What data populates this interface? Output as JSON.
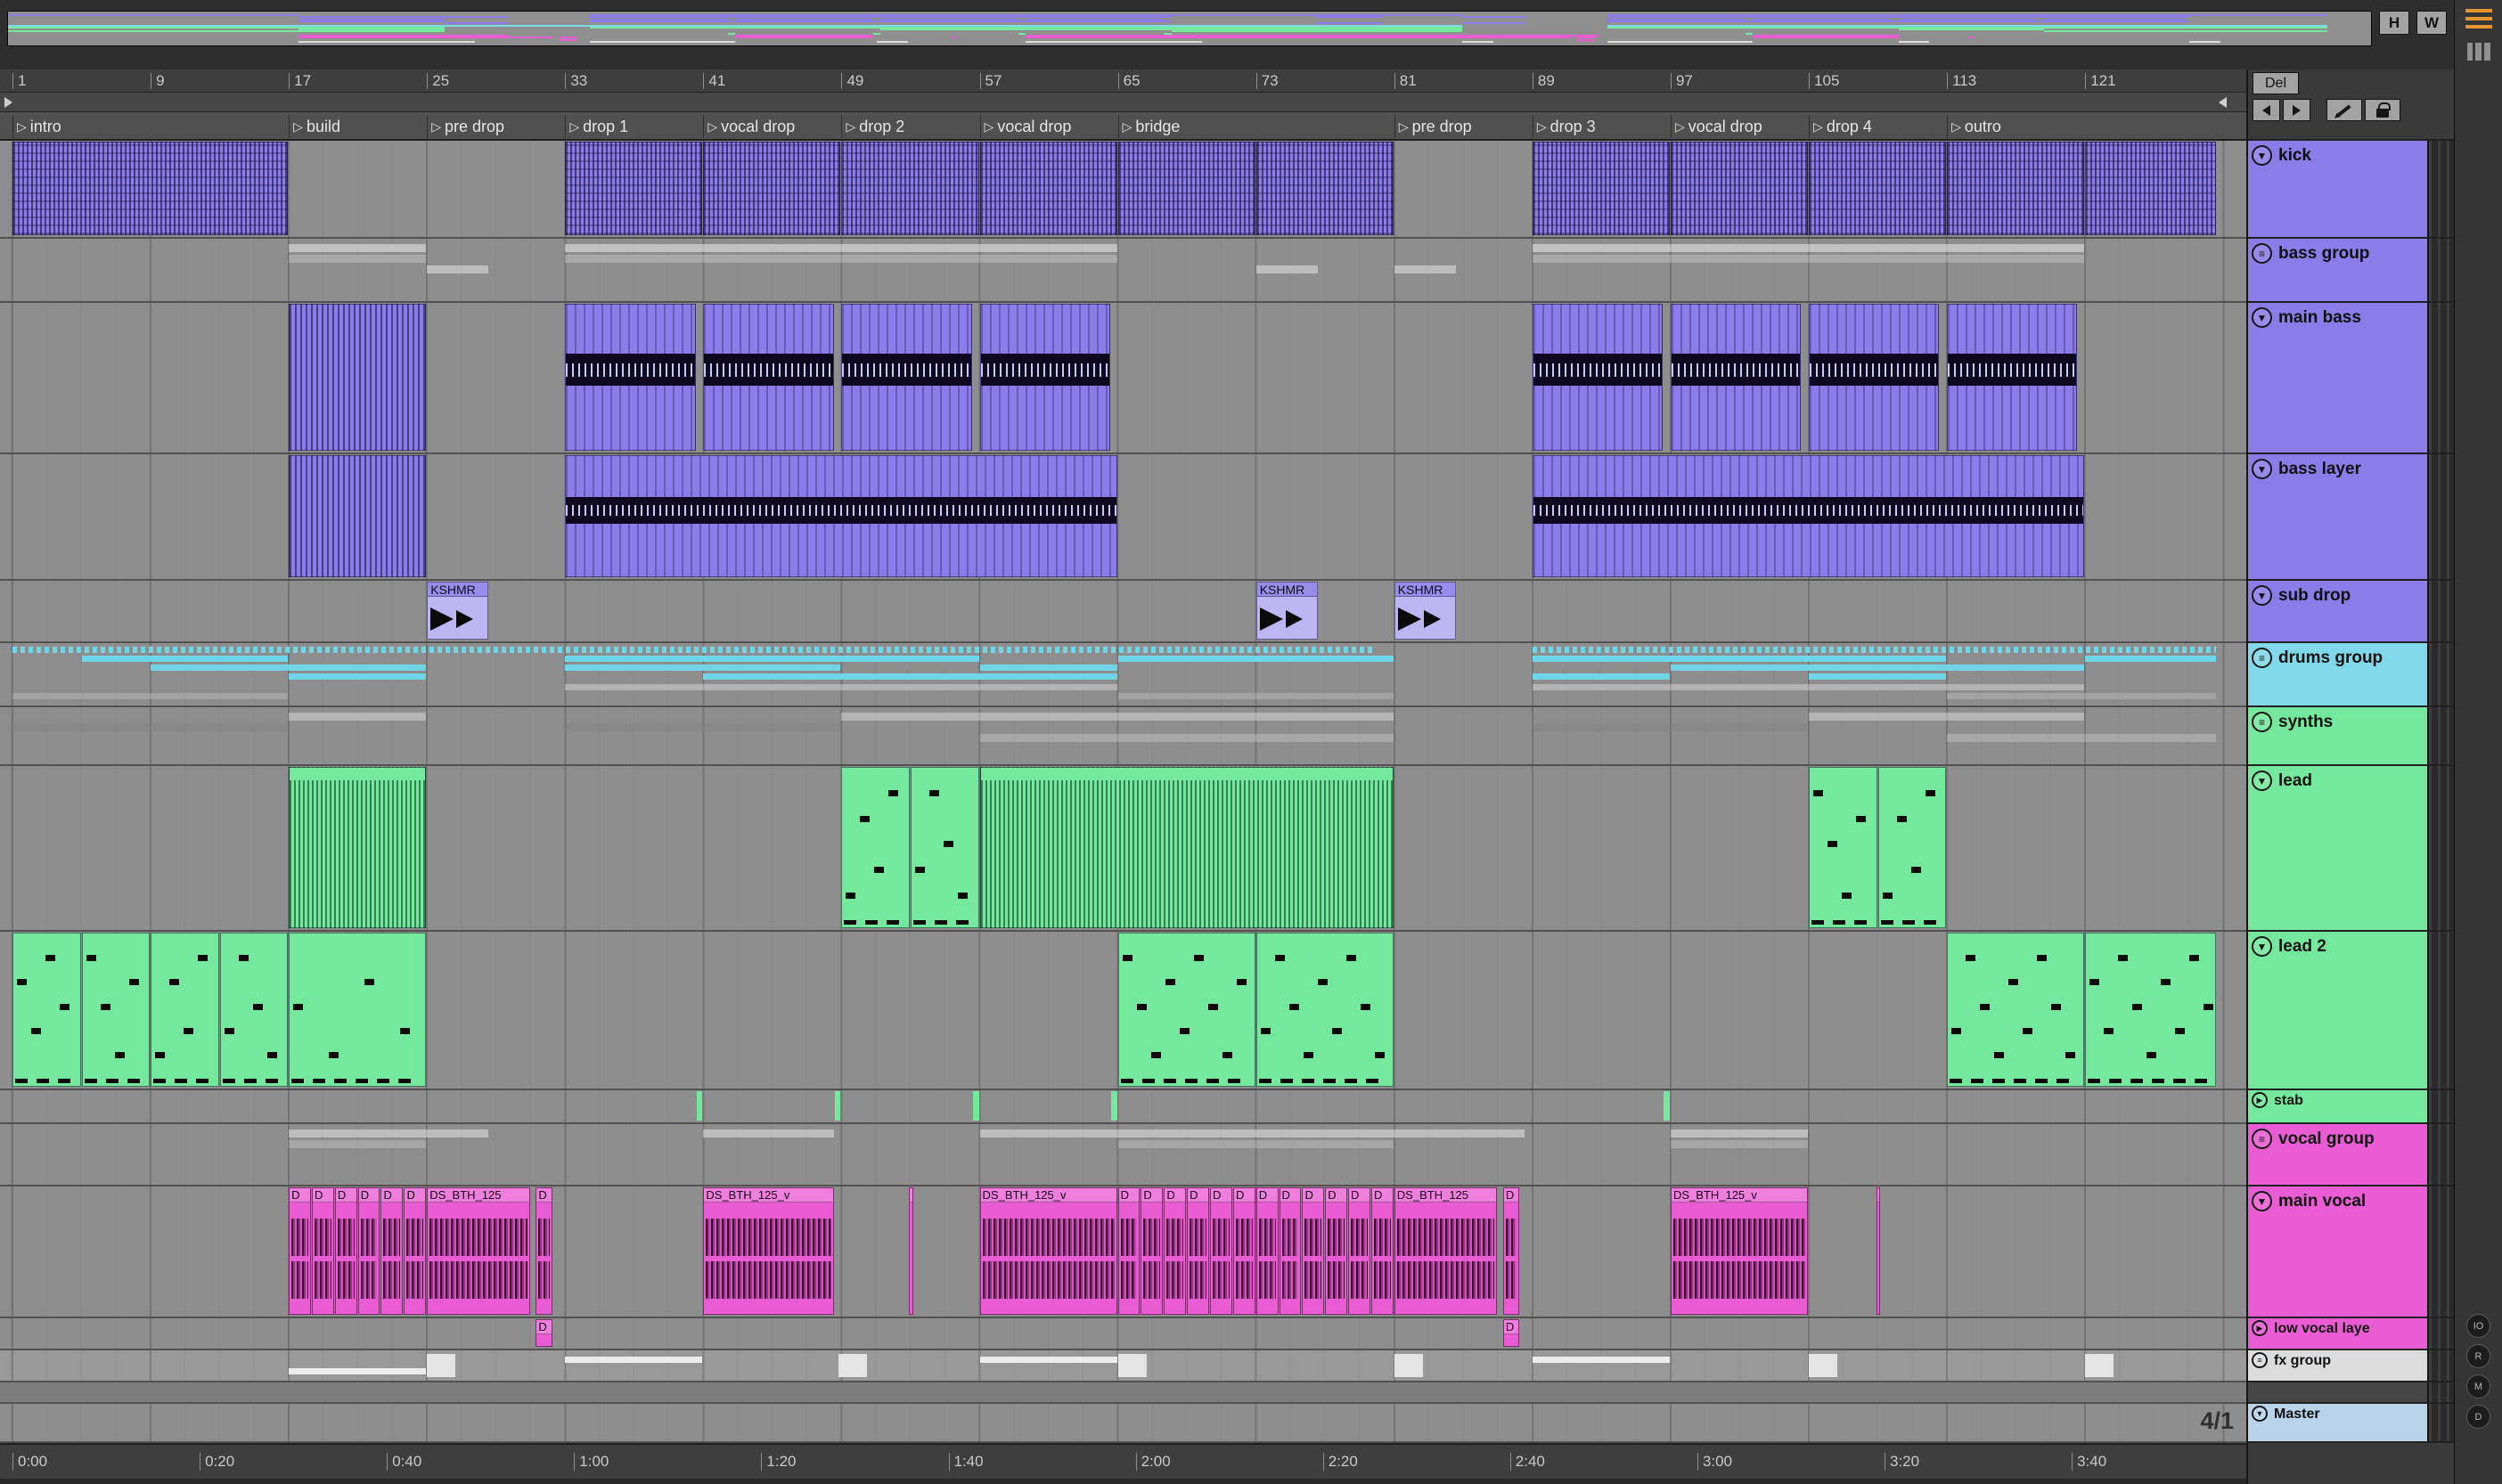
{
  "topbar": {
    "h": "H",
    "w": "W"
  },
  "corner": {
    "del": "Del"
  },
  "colors": {
    "purple": "#8b7ce9",
    "green": "#74e89c",
    "cyan": "#7fd9e9",
    "magenta": "#ea5cd3",
    "master_blue": "#b9d4ea",
    "selected_gray": "#dcdcdc",
    "menu_orange": "#e8952e"
  },
  "timeline": {
    "bar_numbers": [
      "1",
      "9",
      "17",
      "25",
      "33",
      "41",
      "49",
      "57",
      "65",
      "73",
      "81",
      "89",
      "97",
      "105",
      "113",
      "121"
    ]
  },
  "locators": [
    {
      "name": "intro",
      "bar": 1
    },
    {
      "name": "build",
      "bar": 17
    },
    {
      "name": "pre drop",
      "bar": 25
    },
    {
      "name": "drop 1",
      "bar": 33
    },
    {
      "name": "vocal drop",
      "bar": 41
    },
    {
      "name": "drop 2",
      "bar": 49
    },
    {
      "name": "vocal drop",
      "bar": 57
    },
    {
      "name": "bridge",
      "bar": 65
    },
    {
      "name": "pre drop",
      "bar": 81
    },
    {
      "name": "drop 3",
      "bar": 89
    },
    {
      "name": "vocal drop",
      "bar": 97
    },
    {
      "name": "drop 4",
      "bar": 105
    },
    {
      "name": "outro",
      "bar": 113
    }
  ],
  "time_ruler": [
    "0:00",
    "0:20",
    "0:40",
    "1:00",
    "1:20",
    "1:40",
    "2:00",
    "2:20",
    "2:40",
    "3:00",
    "3:20",
    "3:40"
  ],
  "right_rail": {
    "menu_icon": "hamburger-menu",
    "panel_icon": "panel-toggle",
    "circles": [
      "IO",
      "R",
      "M",
      "D"
    ]
  },
  "tracks": [
    {
      "name": "kick",
      "color": "#8b7ce9",
      "height": 110,
      "icon": "fold-open",
      "clips": [
        {
          "s": 1,
          "e": 17,
          "t": "kick"
        },
        {
          "s": 33,
          "e": 41,
          "t": "kick"
        },
        {
          "s": 41,
          "e": 49,
          "t": "kick"
        },
        {
          "s": 49,
          "e": 57,
          "t": "kick"
        },
        {
          "s": 57,
          "e": 65,
          "t": "kick"
        },
        {
          "s": 65,
          "e": 73,
          "t": "kick"
        },
        {
          "s": 73,
          "e": 81,
          "t": "kick"
        },
        {
          "s": 89,
          "e": 97,
          "t": "kick"
        },
        {
          "s": 97,
          "e": 105,
          "t": "kick"
        },
        {
          "s": 105,
          "e": 113,
          "t": "kick"
        },
        {
          "s": 113,
          "e": 121,
          "t": "kick"
        },
        {
          "s": 121,
          "e": 128.6,
          "t": "kick"
        }
      ]
    },
    {
      "name": "bass group",
      "color": "#8b7ce9",
      "height": 72,
      "icon": "unfold-group",
      "clips": [
        {
          "s": 17,
          "e": 25,
          "t": "bar",
          "y": 6,
          "h": 9,
          "c": "rgba(235,235,235,0.55)"
        },
        {
          "s": 33,
          "e": 65,
          "t": "bar",
          "y": 6,
          "h": 9,
          "c": "rgba(235,235,235,0.55)"
        },
        {
          "s": 89,
          "e": 121,
          "t": "bar",
          "y": 6,
          "h": 9,
          "c": "rgba(235,235,235,0.55)"
        },
        {
          "s": 17,
          "e": 25,
          "t": "bar",
          "y": 18,
          "h": 9,
          "c": "rgba(210,210,210,0.4)"
        },
        {
          "s": 33,
          "e": 65,
          "t": "bar",
          "y": 18,
          "h": 9,
          "c": "rgba(210,210,210,0.4)"
        },
        {
          "s": 89,
          "e": 121,
          "t": "bar",
          "y": 18,
          "h": 9,
          "c": "rgba(210,210,210,0.4)"
        },
        {
          "s": 25,
          "e": 28.6,
          "t": "bar",
          "y": 30,
          "h": 9,
          "c": "rgba(235,235,235,0.5)"
        },
        {
          "s": 73,
          "e": 76.6,
          "t": "bar",
          "y": 30,
          "h": 9,
          "c": "rgba(235,235,235,0.5)"
        },
        {
          "s": 81,
          "e": 84.6,
          "t": "bar",
          "y": 30,
          "h": 9,
          "c": "rgba(235,235,235,0.5)"
        }
      ]
    },
    {
      "name": "main bass",
      "color": "#8b7ce9",
      "height": 170,
      "icon": "fold-open",
      "clips": [
        {
          "s": 17,
          "e": 25,
          "t": "bstripe"
        },
        {
          "s": 33,
          "e": 40.6,
          "t": "bass"
        },
        {
          "s": 41,
          "e": 48.6,
          "t": "bass"
        },
        {
          "s": 49,
          "e": 56.6,
          "t": "bass"
        },
        {
          "s": 57,
          "e": 64.6,
          "t": "bass"
        },
        {
          "s": 89,
          "e": 96.6,
          "t": "bass"
        },
        {
          "s": 97,
          "e": 104.6,
          "t": "bass"
        },
        {
          "s": 105,
          "e": 112.6,
          "t": "bass"
        },
        {
          "s": 113,
          "e": 120.6,
          "t": "bass"
        }
      ]
    },
    {
      "name": "bass layer",
      "color": "#8b7ce9",
      "height": 142,
      "icon": "fold-open",
      "clips": [
        {
          "s": 17,
          "e": 25,
          "t": "bstripe"
        },
        {
          "s": 33,
          "e": 65,
          "t": "bass"
        },
        {
          "s": 89,
          "e": 121,
          "t": "bass"
        }
      ]
    },
    {
      "name": "sub drop",
      "color": "#8b7ce9",
      "height": 70,
      "icon": "fold-open",
      "clips": [
        {
          "s": 25,
          "e": 28.6,
          "t": "kshmr",
          "name": "KSHMR"
        },
        {
          "s": 73,
          "e": 76.6,
          "t": "kshmr",
          "name": "KSHMR"
        },
        {
          "s": 81,
          "e": 84.6,
          "t": "kshmr",
          "name": "KSHMR"
        }
      ]
    },
    {
      "name": "drums group",
      "color": "#7fd9e9",
      "height": 72,
      "icon": "unfold-group",
      "clips": [
        {
          "s": 1,
          "e": 80,
          "t": "bar",
          "y": 4,
          "h": 7,
          "c": "#6fd6ea",
          "dash": true
        },
        {
          "s": 89,
          "e": 128.6,
          "t": "bar",
          "y": 4,
          "h": 7,
          "c": "#6fd6ea",
          "dash": true
        },
        {
          "s": 5,
          "e": 17,
          "t": "bar",
          "y": 14,
          "h": 7,
          "c": "#6fd6ea"
        },
        {
          "s": 33,
          "e": 57,
          "t": "bar",
          "y": 14,
          "h": 7,
          "c": "#6fd6ea"
        },
        {
          "s": 65,
          "e": 81,
          "t": "bar",
          "y": 14,
          "h": 7,
          "c": "#6fd6ea"
        },
        {
          "s": 89,
          "e": 113,
          "t": "bar",
          "y": 14,
          "h": 7,
          "c": "#6fd6ea"
        },
        {
          "s": 121,
          "e": 128.6,
          "t": "bar",
          "y": 14,
          "h": 7,
          "c": "#6fd6ea"
        },
        {
          "s": 9,
          "e": 25,
          "t": "bar",
          "y": 24,
          "h": 7,
          "c": "#6fd6ea"
        },
        {
          "s": 33,
          "e": 49,
          "t": "bar",
          "y": 24,
          "h": 7,
          "c": "#6fd6ea"
        },
        {
          "s": 57,
          "e": 65,
          "t": "bar",
          "y": 24,
          "h": 7,
          "c": "#6fd6ea"
        },
        {
          "s": 97,
          "e": 121,
          "t": "bar",
          "y": 24,
          "h": 7,
          "c": "#6fd6ea"
        },
        {
          "s": 17,
          "e": 25,
          "t": "bar",
          "y": 34,
          "h": 7,
          "c": "#6fd6ea"
        },
        {
          "s": 41,
          "e": 65,
          "t": "bar",
          "y": 34,
          "h": 7,
          "c": "#6fd6ea"
        },
        {
          "s": 89,
          "e": 97,
          "t": "bar",
          "y": 34,
          "h": 7,
          "c": "#6fd6ea"
        },
        {
          "s": 105,
          "e": 113,
          "t": "bar",
          "y": 34,
          "h": 7,
          "c": "#6fd6ea"
        },
        {
          "s": 33,
          "e": 65,
          "t": "bar",
          "y": 46,
          "h": 7,
          "c": "rgba(225,225,225,0.45)"
        },
        {
          "s": 89,
          "e": 121,
          "t": "bar",
          "y": 46,
          "h": 7,
          "c": "rgba(225,225,225,0.45)"
        },
        {
          "s": 1,
          "e": 17,
          "t": "bar",
          "y": 56,
          "h": 7,
          "c": "rgba(195,195,195,0.4)"
        },
        {
          "s": 65,
          "e": 81,
          "t": "bar",
          "y": 56,
          "h": 7,
          "c": "rgba(195,195,195,0.4)"
        },
        {
          "s": 113,
          "e": 128.6,
          "t": "bar",
          "y": 56,
          "h": 7,
          "c": "rgba(195,195,195,0.4)"
        }
      ]
    },
    {
      "name": "synths",
      "color": "#74e89c",
      "height": 66,
      "icon": "unfold-group",
      "clips": [
        {
          "s": 17,
          "e": 25,
          "t": "bar",
          "y": 6,
          "h": 9,
          "c": "rgba(228,228,228,0.45)"
        },
        {
          "s": 49,
          "e": 81,
          "t": "bar",
          "y": 6,
          "h": 9,
          "c": "rgba(228,228,228,0.45)"
        },
        {
          "s": 105,
          "e": 121,
          "t": "bar",
          "y": 6,
          "h": 9,
          "c": "rgba(228,228,228,0.45)"
        },
        {
          "s": 1,
          "e": 17,
          "t": "bar",
          "y": 18,
          "h": 9,
          "c": "rgba(130,130,130,0.5)"
        },
        {
          "s": 33,
          "e": 49,
          "t": "bar",
          "y": 18,
          "h": 9,
          "c": "rgba(130,130,130,0.5)"
        },
        {
          "s": 89,
          "e": 105,
          "t": "bar",
          "y": 18,
          "h": 9,
          "c": "rgba(130,130,130,0.5)"
        },
        {
          "s": 57,
          "e": 81,
          "t": "bar",
          "y": 30,
          "h": 9,
          "c": "rgba(228,228,228,0.3)"
        },
        {
          "s": 113,
          "e": 128.6,
          "t": "bar",
          "y": 30,
          "h": 9,
          "c": "rgba(228,228,228,0.3)"
        }
      ]
    },
    {
      "name": "lead",
      "color": "#74e89c",
      "height": 186,
      "icon": "fold-open",
      "clips": [
        {
          "s": 17,
          "e": 25,
          "t": "arp"
        },
        {
          "s": 49,
          "e": 53,
          "t": "notes"
        },
        {
          "s": 53,
          "e": 57,
          "t": "notes"
        },
        {
          "s": 57,
          "e": 81,
          "t": "arp"
        },
        {
          "s": 105,
          "e": 109,
          "t": "notes"
        },
        {
          "s": 109,
          "e": 113,
          "t": "notes"
        }
      ]
    },
    {
      "name": "lead 2",
      "color": "#74e89c",
      "height": 178,
      "icon": "fold-open",
      "clips": [
        {
          "s": 1,
          "e": 5,
          "t": "notes"
        },
        {
          "s": 5,
          "e": 9,
          "t": "notes"
        },
        {
          "s": 9,
          "e": 13,
          "t": "notes"
        },
        {
          "s": 13,
          "e": 17,
          "t": "notes"
        },
        {
          "s": 17,
          "e": 25,
          "t": "sparse"
        },
        {
          "s": 65,
          "e": 73,
          "t": "notes"
        },
        {
          "s": 73,
          "e": 81,
          "t": "notes"
        },
        {
          "s": 113,
          "e": 121,
          "t": "notes"
        },
        {
          "s": 121,
          "e": 128.6,
          "t": "notes"
        }
      ]
    },
    {
      "name": "stab",
      "color": "#74e89c",
      "height": 38,
      "icon": "fold-closed",
      "clips": [
        {
          "s": 40.6,
          "e": 41,
          "t": "tick"
        },
        {
          "s": 48.6,
          "e": 49,
          "t": "tick"
        },
        {
          "s": 56.6,
          "e": 57,
          "t": "tick"
        },
        {
          "s": 64.6,
          "e": 65,
          "t": "tick"
        },
        {
          "s": 96.6,
          "e": 97,
          "t": "tick"
        }
      ]
    },
    {
      "name": "vocal group",
      "color": "#ea5cd3",
      "height": 70,
      "icon": "unfold-group",
      "clips": [
        {
          "s": 17,
          "e": 28.6,
          "t": "bar",
          "y": 6,
          "h": 9,
          "c": "rgba(235,235,235,0.5)"
        },
        {
          "s": 41,
          "e": 48.6,
          "t": "bar",
          "y": 6,
          "h": 9,
          "c": "rgba(235,235,235,0.5)"
        },
        {
          "s": 57,
          "e": 88.6,
          "t": "bar",
          "y": 6,
          "h": 9,
          "c": "rgba(235,235,235,0.5)"
        },
        {
          "s": 97,
          "e": 105,
          "t": "bar",
          "y": 6,
          "h": 9,
          "c": "rgba(235,235,235,0.5)"
        },
        {
          "s": 17,
          "e": 25,
          "t": "bar",
          "y": 18,
          "h": 9,
          "c": "rgba(210,210,210,0.35)"
        },
        {
          "s": 65,
          "e": 81,
          "t": "bar",
          "y": 18,
          "h": 9,
          "c": "rgba(210,210,210,0.35)"
        },
        {
          "s": 97,
          "e": 105,
          "t": "bar",
          "y": 18,
          "h": 9,
          "c": "rgba(210,210,210,0.35)"
        }
      ]
    },
    {
      "name": "main vocal",
      "color": "#ea5cd3",
      "height": 148,
      "icon": "fold-open",
      "clips": [
        {
          "s": 17,
          "e": 18.33,
          "t": "vocal",
          "name": "D"
        },
        {
          "s": 18.33,
          "e": 19.67,
          "t": "vocal",
          "name": "D"
        },
        {
          "s": 19.67,
          "e": 21,
          "t": "vocal",
          "name": "D"
        },
        {
          "s": 21,
          "e": 22.33,
          "t": "vocal",
          "name": "D"
        },
        {
          "s": 22.33,
          "e": 23.67,
          "t": "vocal",
          "name": "D"
        },
        {
          "s": 23.67,
          "e": 25,
          "t": "vocal",
          "name": "D"
        },
        {
          "s": 25,
          "e": 31,
          "t": "vocal",
          "name": "DS_BTH_125"
        },
        {
          "s": 31.3,
          "e": 32.3,
          "t": "vocal",
          "name": "D"
        },
        {
          "s": 41,
          "e": 48.6,
          "t": "vocal",
          "name": "DS_BTH_125_v"
        },
        {
          "s": 52.9,
          "e": 53.2,
          "t": "vocal",
          "name": ""
        },
        {
          "s": 57,
          "e": 65,
          "t": "vocal",
          "name": "DS_BTH_125_v"
        },
        {
          "s": 65,
          "e": 66.33,
          "t": "vocal",
          "name": "D"
        },
        {
          "s": 66.33,
          "e": 67.67,
          "t": "vocal",
          "name": "D"
        },
        {
          "s": 67.67,
          "e": 69,
          "t": "vocal",
          "name": "D"
        },
        {
          "s": 69,
          "e": 70.33,
          "t": "vocal",
          "name": "D"
        },
        {
          "s": 70.33,
          "e": 71.67,
          "t": "vocal",
          "name": "D"
        },
        {
          "s": 71.67,
          "e": 73,
          "t": "vocal",
          "name": "D"
        },
        {
          "s": 73,
          "e": 74.33,
          "t": "vocal",
          "name": "D"
        },
        {
          "s": 74.33,
          "e": 75.67,
          "t": "vocal",
          "name": "D"
        },
        {
          "s": 75.67,
          "e": 77,
          "t": "vocal",
          "name": "D"
        },
        {
          "s": 77,
          "e": 78.33,
          "t": "vocal",
          "name": "D"
        },
        {
          "s": 78.33,
          "e": 79.67,
          "t": "vocal",
          "name": "D"
        },
        {
          "s": 79.67,
          "e": 81,
          "t": "vocal",
          "name": "D"
        },
        {
          "s": 81,
          "e": 87,
          "t": "vocal",
          "name": "DS_BTH_125"
        },
        {
          "s": 87.3,
          "e": 88.3,
          "t": "vocal",
          "name": "D"
        },
        {
          "s": 97,
          "e": 105,
          "t": "vocal",
          "name": "DS_BTH_125_v"
        },
        {
          "s": 108.9,
          "e": 109.2,
          "t": "vocal",
          "name": ""
        }
      ]
    },
    {
      "name": "low vocal laye",
      "color": "#ea5cd3",
      "height": 36,
      "icon": "fold-closed",
      "clips": [
        {
          "s": 31.3,
          "e": 32.3,
          "t": "vocal",
          "name": "D"
        },
        {
          "s": 87.3,
          "e": 88.3,
          "t": "vocal",
          "name": "D"
        }
      ]
    },
    {
      "name": "fx group",
      "color": "#dcdcdc",
      "height": 36,
      "icon": "unfold-group",
      "lane_light": true,
      "clips": [
        {
          "s": 17,
          "e": 25,
          "t": "bar",
          "y": 20,
          "h": 7,
          "c": "#ececec"
        },
        {
          "s": 33,
          "e": 41,
          "t": "bar",
          "y": 7,
          "h": 7,
          "c": "#ececec"
        },
        {
          "s": 57,
          "e": 65,
          "t": "bar",
          "y": 7,
          "h": 7,
          "c": "#ececec"
        },
        {
          "s": 89,
          "e": 97,
          "t": "bar",
          "y": 7,
          "h": 7,
          "c": "#ececec"
        },
        {
          "s": 25,
          "e": 26.7,
          "t": "bar",
          "y": 4,
          "h": 26,
          "c": "#e4e4e4"
        },
        {
          "s": 48.8,
          "e": 50.5,
          "t": "bar",
          "y": 4,
          "h": 26,
          "c": "#e4e4e4"
        },
        {
          "s": 65,
          "e": 66.7,
          "t": "bar",
          "y": 4,
          "h": 26,
          "c": "#e4e4e4"
        },
        {
          "s": 81,
          "e": 82.7,
          "t": "bar",
          "y": 4,
          "h": 26,
          "c": "#e4e4e4"
        },
        {
          "s": 105,
          "e": 106.7,
          "t": "bar",
          "y": 4,
          "h": 26,
          "c": "#e4e4e4"
        },
        {
          "s": 121,
          "e": 122.7,
          "t": "bar",
          "y": 4,
          "h": 26,
          "c": "#e4e4e4"
        }
      ]
    },
    {
      "name": "",
      "spacer": true,
      "height": 24,
      "clips": []
    },
    {
      "name": "Master",
      "color": "#b9d4ea",
      "height": 44,
      "icon": "fold-open",
      "display": "4/1",
      "clips": []
    }
  ]
}
